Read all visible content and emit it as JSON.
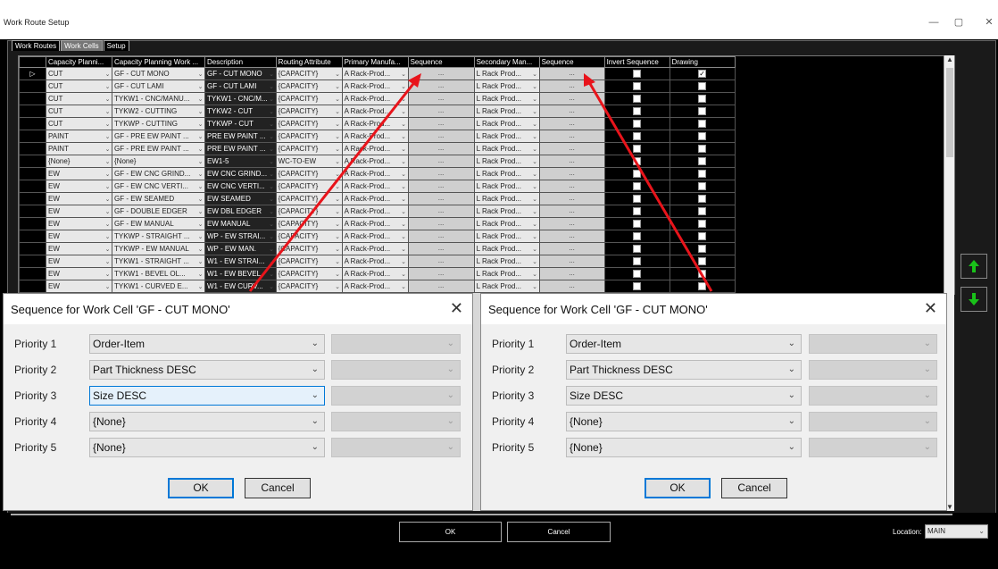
{
  "window": {
    "title": "Work Route Setup",
    "minimize": "—",
    "maximize": "▢",
    "close": "✕"
  },
  "tabs": [
    "Work Routes",
    "Work Cells",
    "Setup"
  ],
  "grid": {
    "columns": [
      "",
      "Capacity Planni...",
      "Capacity Planning Work ...",
      "Description",
      "Routing Attribute",
      "Primary Manufa...",
      "Sequence",
      "Secondary Man...",
      "Sequence",
      "Invert Sequence",
      "Drawing"
    ],
    "sequence_button": "...",
    "rows": [
      {
        "ind": "▷",
        "cap": "CUT",
        "work": "GF - CUT MONO",
        "desc": "GF - CUT MONO",
        "route": "{CAPACITY}",
        "prim": "A Rack-Prod...",
        "sec": "L Rack Prod...",
        "invert": false,
        "drawing": true
      },
      {
        "ind": "",
        "cap": "CUT",
        "work": "GF - CUT LAMI",
        "desc": "GF - CUT LAMI",
        "route": "{CAPACITY}",
        "prim": "A Rack-Prod...",
        "sec": "L Rack Prod...",
        "invert": false,
        "drawing": false
      },
      {
        "ind": "",
        "cap": "CUT",
        "work": "TYKW1 - CNC/MANU...",
        "desc": "TYKW1 - CNC/M...",
        "route": "{CAPACITY}",
        "prim": "A Rack-Prod...",
        "sec": "L Rack Prod...",
        "invert": false,
        "drawing": false
      },
      {
        "ind": "",
        "cap": "CUT",
        "work": "TYKW2 - CUTTING",
        "desc": "TYKW2 - CUT",
        "route": "{CAPACITY}",
        "prim": "A Rack-Prod...",
        "sec": "L Rack Prod...",
        "invert": false,
        "drawing": false
      },
      {
        "ind": "",
        "cap": "CUT",
        "work": "TYKWP - CUTTING",
        "desc": "TYKWP - CUT",
        "route": "{CAPACITY}",
        "prim": "A Rack-Prod...",
        "sec": "L Rack Prod...",
        "invert": false,
        "drawing": false
      },
      {
        "ind": "",
        "cap": "PAINT",
        "work": "GF - PRE EW PAINT ...",
        "desc": "PRE EW PAINT ...",
        "route": "{CAPACITY}",
        "prim": "A Rack-Prod...",
        "sec": "L Rack Prod...",
        "invert": false,
        "drawing": false
      },
      {
        "ind": "",
        "cap": "PAINT",
        "work": "GF - PRE EW PAINT ...",
        "desc": "PRE EW PAINT ...",
        "route": "{CAPACITY}",
        "prim": "A Rack-Prod...",
        "sec": "L Rack Prod...",
        "invert": false,
        "drawing": false
      },
      {
        "ind": "",
        "cap": "{None}",
        "work": "{None}",
        "desc": "EW1-5",
        "route": "WC-TO-EW",
        "prim": "A Rack-Prod...",
        "sec": "L Rack Prod...",
        "invert": false,
        "drawing": false
      },
      {
        "ind": "",
        "cap": "EW",
        "work": "GF - EW CNC GRIND...",
        "desc": "EW CNC GRIND...",
        "route": "{CAPACITY}",
        "prim": "A Rack-Prod...",
        "sec": "L Rack Prod...",
        "invert": false,
        "drawing": false
      },
      {
        "ind": "",
        "cap": "EW",
        "work": "GF - EW CNC VERTI...",
        "desc": "EW CNC VERTI...",
        "route": "{CAPACITY}",
        "prim": "A Rack-Prod...",
        "sec": "L Rack Prod...",
        "invert": false,
        "drawing": false
      },
      {
        "ind": "",
        "cap": "EW",
        "work": "GF - EW SEAMED",
        "desc": "EW SEAMED",
        "route": "{CAPACITY}",
        "prim": "A Rack-Prod...",
        "sec": "L Rack Prod...",
        "invert": false,
        "drawing": false
      },
      {
        "ind": "",
        "cap": "EW",
        "work": "GF - DOUBLE EDGER",
        "desc": "EW DBL EDGER",
        "route": "{CAPACITY}",
        "prim": "A Rack-Prod...",
        "sec": "L Rack Prod...",
        "invert": false,
        "drawing": false
      },
      {
        "ind": "",
        "cap": "EW",
        "work": "GF - EW MANUAL",
        "desc": "EW MANUAL",
        "route": "{CAPACITY}",
        "prim": "A Rack-Prod...",
        "sec": "L Rack Prod...",
        "invert": false,
        "drawing": false
      },
      {
        "ind": "",
        "cap": "EW",
        "work": "TYKWP - STRAIGHT ...",
        "desc": "WP - EW STRAI...",
        "route": "{CAPACITY}",
        "prim": "A Rack-Prod...",
        "sec": "L Rack Prod...",
        "invert": false,
        "drawing": false
      },
      {
        "ind": "",
        "cap": "EW",
        "work": "TYKWP - EW MANUAL",
        "desc": "WP - EW MAN.",
        "route": "{CAPACITY}",
        "prim": "A Rack-Prod...",
        "sec": "L Rack Prod...",
        "invert": false,
        "drawing": false
      },
      {
        "ind": "",
        "cap": "EW",
        "work": "TYKW1 - STRAIGHT ...",
        "desc": "W1 - EW STRAI...",
        "route": "{CAPACITY}",
        "prim": "A Rack-Prod...",
        "sec": "L Rack Prod...",
        "invert": false,
        "drawing": false
      },
      {
        "ind": "",
        "cap": "EW",
        "work": "TYKW1 - BEVEL OL...",
        "desc": "W1 - EW BEVEL",
        "route": "{CAPACITY}",
        "prim": "A Rack-Prod...",
        "sec": "L Rack Prod...",
        "invert": false,
        "drawing": false
      },
      {
        "ind": "",
        "cap": "EW",
        "work": "TYKW1 - CURVED E...",
        "desc": "W1 - EW CURV...",
        "route": "{CAPACITY}",
        "prim": "A Rack-Prod...",
        "sec": "L Rack Prod...",
        "invert": false,
        "drawing": false
      }
    ]
  },
  "dialog_left": {
    "title": "Sequence for Work Cell 'GF - CUT MONO'",
    "close": "✕",
    "priorities": [
      {
        "label": "Priority 1",
        "value": "Order-Item"
      },
      {
        "label": "Priority 2",
        "value": "Part Thickness DESC"
      },
      {
        "label": "Priority 3",
        "value": "Size DESC"
      },
      {
        "label": "Priority 4",
        "value": "{None}"
      },
      {
        "label": "Priority 5",
        "value": "{None}"
      }
    ],
    "ok": "OK",
    "cancel": "Cancel"
  },
  "dialog_right": {
    "title": "Sequence for Work Cell 'GF - CUT MONO'",
    "close": "✕",
    "priorities": [
      {
        "label": "Priority 1",
        "value": "Order-Item"
      },
      {
        "label": "Priority 2",
        "value": "Part Thickness DESC"
      },
      {
        "label": "Priority 3",
        "value": "Size DESC"
      },
      {
        "label": "Priority 4",
        "value": "{None}"
      },
      {
        "label": "Priority 5",
        "value": "{None}"
      }
    ],
    "ok": "OK",
    "cancel": "Cancel"
  },
  "footer": {
    "ok": "OK",
    "cancel": "Cancel",
    "location_label": "Location:",
    "location_value": "MAIN"
  },
  "colors": {
    "annotation_arrow": "#e8141b",
    "move_arrow": "#19c219",
    "focus_border": "#0078d7"
  },
  "icons": {
    "move_up": "arrow-up-icon",
    "move_down": "arrow-down-icon",
    "dropdown": "chevron-down-icon"
  }
}
